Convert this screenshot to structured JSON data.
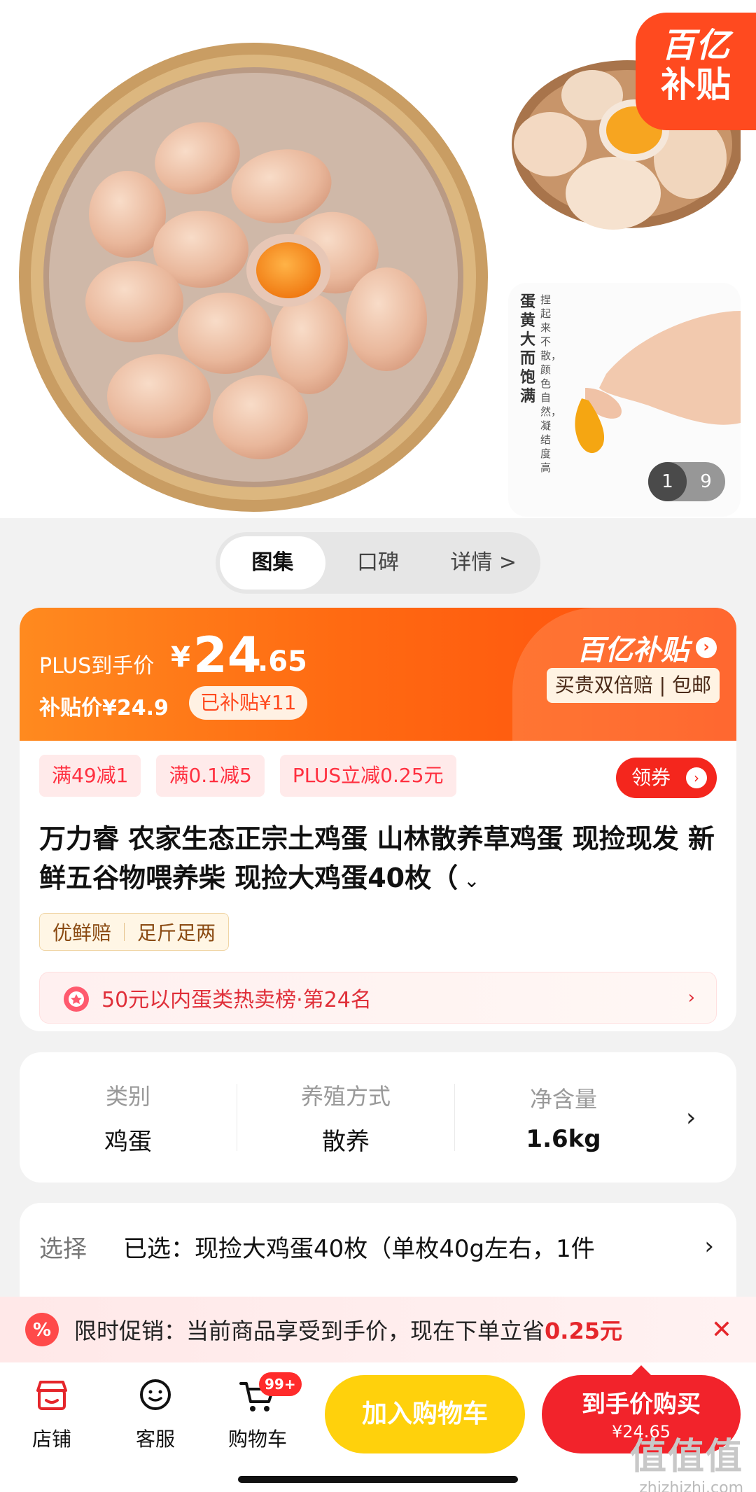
{
  "gallery": {
    "badge_line1": "百亿",
    "badge_line2": "补贴",
    "yolk_title": "蛋黄大而饱满",
    "yolk_sub": "捏起来不散，颜色自然，凝结度高",
    "pager_current": "1",
    "pager_total": "9"
  },
  "tabs": [
    {
      "label": "图集"
    },
    {
      "label": "口碑"
    },
    {
      "label": "详情 >"
    }
  ],
  "price": {
    "plus_label": "PLUS到手价",
    "yen": "¥",
    "main": "24",
    "decimal": ".65",
    "subsidy_price": "补贴价¥24.9",
    "subsidized": "已补贴¥11",
    "brand": "百亿补贴",
    "brand_arrow": "›",
    "guarantee": "买贵双倍赔 | 包邮"
  },
  "coupons": [
    "满49减1",
    "满0.1减5",
    "PLUS立减0.25元"
  ],
  "get_coupon": "领券",
  "title": "万力睿 农家生态正宗土鸡蛋 山林散养草鸡蛋 现捡现发 新鲜五谷物喂养柴 现捡大鸡蛋40枚（",
  "title_more": "⌄",
  "tags": [
    "优鲜赔",
    "足斤足两"
  ],
  "rank": {
    "text": "50元以内蛋类热卖榜·第24名",
    "arrow": "›"
  },
  "attrs": [
    {
      "key": "类别",
      "value": "鸡蛋"
    },
    {
      "key": "养殖方式",
      "value": "散养"
    },
    {
      "key": "净含量",
      "value": "1.6kg"
    }
  ],
  "attr_arrow": "›",
  "select": {
    "label": "选择",
    "value": "已选：现捡大鸡蛋40枚（单枚40g左右，1件",
    "arrow": "›"
  },
  "promo": {
    "prefix": "限时促销：当前商品享受到手价，现在下单立省",
    "amount": "0.25元",
    "close": "✕"
  },
  "bottom": {
    "shop": "店铺",
    "service": "客服",
    "cart": "购物车",
    "cart_badge": "99+",
    "add_cart": "加入购物车",
    "buy_line1": "到手价购买",
    "buy_line2": "¥24.65"
  },
  "watermark": {
    "line1": "值值值",
    "line2": "zhizhizhi.com"
  },
  "colors": {
    "accent": "#ff4a1f",
    "buy": "#f2232b",
    "cart": "#ffd10c"
  }
}
